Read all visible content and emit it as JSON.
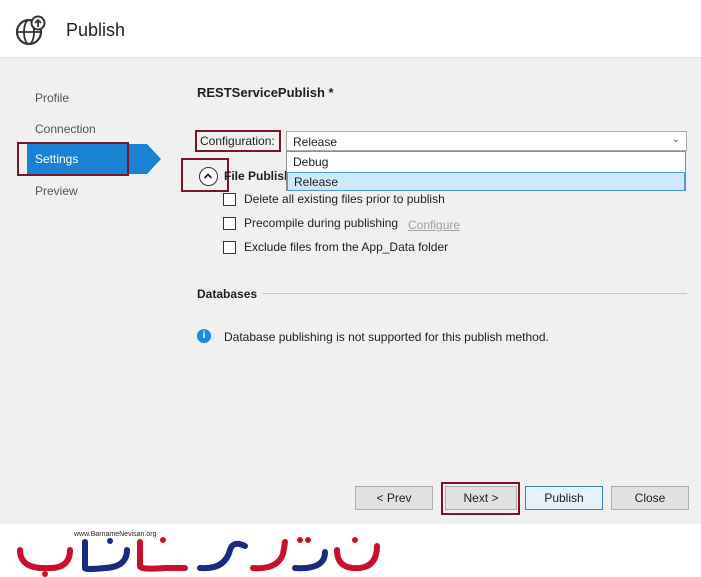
{
  "window": {
    "title": "Publish"
  },
  "nav": {
    "items": [
      {
        "label": "Profile"
      },
      {
        "label": "Connection"
      },
      {
        "label": "Settings"
      },
      {
        "label": "Preview"
      }
    ]
  },
  "settings": {
    "profile_name": "RESTServicePublish *",
    "configuration": {
      "label": "Configuration:",
      "value": "Release",
      "options": [
        "Debug",
        "Release"
      ]
    },
    "file_publish": {
      "title": "File Publish",
      "options": [
        {
          "label": "Delete all existing files prior to publish",
          "checked": false
        },
        {
          "label": "Precompile during publishing",
          "checked": false
        },
        {
          "label": "Exclude files from the App_Data folder",
          "checked": false
        }
      ],
      "configure_link": "Configure"
    },
    "databases": {
      "title": "Databases",
      "info": "Database publishing is not supported for this publish method."
    }
  },
  "buttons": {
    "prev": "< Prev",
    "next": "Next >",
    "publish": "Publish",
    "close": "Close"
  },
  "footer": {
    "url": "www.BarnameNevisan.org",
    "logo_text": "برنامه نویسان"
  },
  "colors": {
    "accent": "#1a82d4",
    "highlight": "#7b1525",
    "logo": "#c8102e"
  }
}
